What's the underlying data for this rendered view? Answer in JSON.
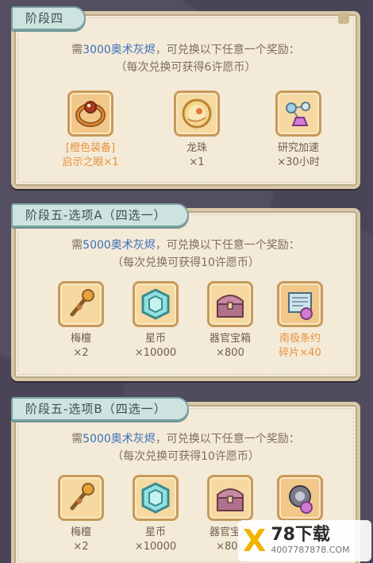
{
  "stage4": {
    "title": "阶段四",
    "desc_pre": "需",
    "desc_amount": "3000奥术灰烬",
    "desc_post": "，可兑换以下任意一个奖励：",
    "desc_line2": "（每次兑换可获得6许愿币）",
    "items": [
      {
        "icon": "ring-icon",
        "name": "[橙色装备]",
        "qty": "启示之眼×1",
        "highlight": true
      },
      {
        "icon": "dragon-orb-icon",
        "name": "龙珠",
        "qty": "×1",
        "highlight": false
      },
      {
        "icon": "research-flask-icon",
        "name": "研究加速",
        "qty": "×30小时",
        "highlight": false
      }
    ]
  },
  "stage5a": {
    "title": "阶段五-选项A（四选一）",
    "desc_pre": "需",
    "desc_amount": "5000奥术灰烬",
    "desc_post": "，可兑换以下任意一个奖励：",
    "desc_line2": "（每次兑换可获得10许愿币）",
    "items": [
      {
        "icon": "torch-icon",
        "name": "梅檀",
        "qty": "×2",
        "highlight": false
      },
      {
        "icon": "star-coin-icon",
        "name": "星币",
        "qty": "×10000",
        "highlight": false
      },
      {
        "icon": "chest-icon",
        "name": "器官宝箱",
        "qty": "×800",
        "highlight": false
      },
      {
        "icon": "scroll-icon",
        "name": "南极条约",
        "qty": "碎片×40",
        "highlight": true
      }
    ]
  },
  "stage5b": {
    "title": "阶段五-选项B（四选一）",
    "desc_pre": "需",
    "desc_amount": "5000奥术灰烬",
    "desc_post": "，可兑换以下任意一个奖励：",
    "desc_line2": "（每次兑换可获得10许愿币）",
    "items": [
      {
        "icon": "torch-icon",
        "name": "梅檀",
        "qty": "×2",
        "highlight": false
      },
      {
        "icon": "star-coin-icon",
        "name": "星币",
        "qty": "×10000",
        "highlight": false
      },
      {
        "icon": "chest-icon",
        "name": "器官宝箱",
        "qty": "×800",
        "highlight": false
      },
      {
        "icon": "gear-fragment-icon",
        "name": "",
        "qty": "",
        "highlight": true
      }
    ]
  },
  "watermark": {
    "title": "78下载",
    "url": "4007787878.COM"
  },
  "colors": {
    "panel_bg": "#f4ead8",
    "accent_blue": "#3a6fb8",
    "highlight_orange": "#e8923a",
    "tab_bg": "#cde3df"
  }
}
